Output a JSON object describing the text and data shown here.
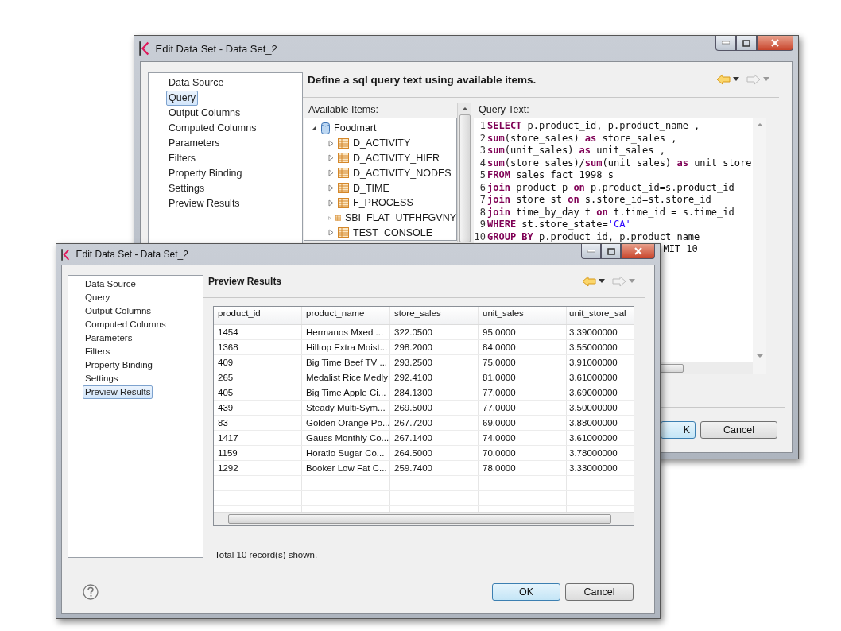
{
  "back_window": {
    "title": "Edit Data Set - Data Set_2",
    "nav": [
      {
        "label": "Data Source",
        "selected": false
      },
      {
        "label": "Query",
        "selected": true
      },
      {
        "label": "Output Columns",
        "selected": false
      },
      {
        "label": "Computed Columns",
        "selected": false
      },
      {
        "label": "Parameters",
        "selected": false
      },
      {
        "label": "Filters",
        "selected": false
      },
      {
        "label": "Property Binding",
        "selected": false
      },
      {
        "label": "Settings",
        "selected": false
      },
      {
        "label": "Preview Results",
        "selected": false
      }
    ],
    "heading": "Define a sql query text using available items.",
    "available_label": "Available Items:",
    "tree": {
      "label": "Foodmart",
      "expanded": true,
      "children": [
        {
          "label": "D_ACTIVITY",
          "expanded": false
        },
        {
          "label": "D_ACTIVITY_HIER",
          "expanded": false
        },
        {
          "label": "D_ACTIVITY_NODES",
          "expanded": false
        },
        {
          "label": "D_TIME",
          "expanded": false
        },
        {
          "label": "F_PROCESS",
          "expanded": false
        },
        {
          "label": "SBI_FLAT_UTFHFGVNY",
          "expanded": false
        },
        {
          "label": "TEST_CONSOLE",
          "expanded": false
        }
      ]
    },
    "query_label": "Query Text:",
    "query_lines": [
      {
        "num": "1",
        "tokens": [
          {
            "kind": "keyword",
            "text": "SELECT"
          },
          {
            "kind": "plain",
            "text": " p.product_id, p.product_name ,"
          }
        ]
      },
      {
        "num": "2",
        "tokens": [
          {
            "kind": "keyword",
            "text": "sum"
          },
          {
            "kind": "plain",
            "text": "(store_sales) "
          },
          {
            "kind": "keyword",
            "text": "as"
          },
          {
            "kind": "plain",
            "text": " store_sales ,"
          }
        ]
      },
      {
        "num": "3",
        "tokens": [
          {
            "kind": "keyword",
            "text": "sum"
          },
          {
            "kind": "plain",
            "text": "(unit_sales) "
          },
          {
            "kind": "keyword",
            "text": "as"
          },
          {
            "kind": "plain",
            "text": " unit_sales ,"
          }
        ]
      },
      {
        "num": "4",
        "tokens": [
          {
            "kind": "keyword",
            "text": "sum"
          },
          {
            "kind": "plain",
            "text": "(store_sales)/"
          },
          {
            "kind": "keyword",
            "text": "sum"
          },
          {
            "kind": "plain",
            "text": "(unit_sales) "
          },
          {
            "kind": "keyword",
            "text": "as"
          },
          {
            "kind": "plain",
            "text": " unit_store"
          }
        ]
      },
      {
        "num": "5",
        "tokens": [
          {
            "kind": "keyword",
            "text": "FROM"
          },
          {
            "kind": "plain",
            "text": " sales_fact_1998 s"
          }
        ]
      },
      {
        "num": "6",
        "tokens": [
          {
            "kind": "keyword",
            "text": "join"
          },
          {
            "kind": "plain",
            "text": " product p "
          },
          {
            "kind": "keyword",
            "text": "on"
          },
          {
            "kind": "plain",
            "text": " p.product_id=s.product_id"
          }
        ]
      },
      {
        "num": "7",
        "tokens": [
          {
            "kind": "keyword",
            "text": "join"
          },
          {
            "kind": "plain",
            "text": " store st "
          },
          {
            "kind": "keyword",
            "text": "on"
          },
          {
            "kind": "plain",
            "text": " s.store_id=st.store_id"
          }
        ]
      },
      {
        "num": "8",
        "tokens": [
          {
            "kind": "keyword",
            "text": "join"
          },
          {
            "kind": "plain",
            "text": " time_by_day t "
          },
          {
            "kind": "keyword",
            "text": "on"
          },
          {
            "kind": "plain",
            "text": " t.time_id = s.time_id"
          }
        ]
      },
      {
        "num": "9",
        "tokens": [
          {
            "kind": "keyword",
            "text": "WHERE"
          },
          {
            "kind": "plain",
            "text": " st.store_state="
          },
          {
            "kind": "string",
            "text": "'CA'"
          }
        ]
      },
      {
        "num": "10",
        "tokens": [
          {
            "kind": "keyword",
            "text": "GROUP BY"
          },
          {
            "kind": "plain",
            "text": " p.product_id, p.product_name"
          }
        ]
      },
      {
        "tokens": [
          {
            "kind": "plain",
            "text": "MIT 10"
          }
        ]
      }
    ],
    "buttons": [
      {
        "label": "K",
        "kind": "default"
      },
      {
        "label": "Cancel",
        "kind": "normal"
      }
    ]
  },
  "front_window": {
    "title": "Edit Data Set - Data Set_2",
    "nav": [
      {
        "label": "Data Source",
        "selected": false
      },
      {
        "label": "Query",
        "selected": false
      },
      {
        "label": "Output Columns",
        "selected": false
      },
      {
        "label": "Computed Columns",
        "selected": false
      },
      {
        "label": "Parameters",
        "selected": false
      },
      {
        "label": "Filters",
        "selected": false
      },
      {
        "label": "Property Binding",
        "selected": false
      },
      {
        "label": "Settings",
        "selected": false
      },
      {
        "label": "Preview Results",
        "selected": true
      }
    ],
    "heading": "Preview Results",
    "table": {
      "columns": [
        "product_id",
        "product_name",
        "store_sales",
        "unit_sales",
        "unit_store_sal"
      ],
      "rows": [
        [
          "1454",
          "Hermanos Mxed ...",
          "322.0500",
          "95.0000",
          "3.39000000"
        ],
        [
          "1368",
          "Hilltop Extra Moist...",
          "298.2000",
          "84.0000",
          "3.55000000"
        ],
        [
          "409",
          "Big Time Beef TV ...",
          "293.2500",
          "75.0000",
          "3.91000000"
        ],
        [
          "265",
          "Medalist Rice Medly",
          "292.4100",
          "81.0000",
          "3.61000000"
        ],
        [
          "405",
          "Big Time Apple Ci...",
          "284.1300",
          "77.0000",
          "3.69000000"
        ],
        [
          "439",
          "Steady Multi-Sym...",
          "269.5000",
          "77.0000",
          "3.50000000"
        ],
        [
          "83",
          "Golden Orange Po...",
          "267.7200",
          "69.0000",
          "3.88000000"
        ],
        [
          "1417",
          "Gauss Monthly Co...",
          "267.1400",
          "74.0000",
          "3.61000000"
        ],
        [
          "1159",
          "Horatio Sugar Co...",
          "264.5000",
          "70.0000",
          "3.78000000"
        ],
        [
          "1292",
          "Booker Low Fat C...",
          "259.7400",
          "78.0000",
          "3.33000000"
        ]
      ]
    },
    "status": "Total 10 record(s) shown.",
    "buttons": [
      {
        "label": "OK",
        "kind": "default"
      },
      {
        "label": "Cancel",
        "kind": "normal"
      }
    ]
  }
}
